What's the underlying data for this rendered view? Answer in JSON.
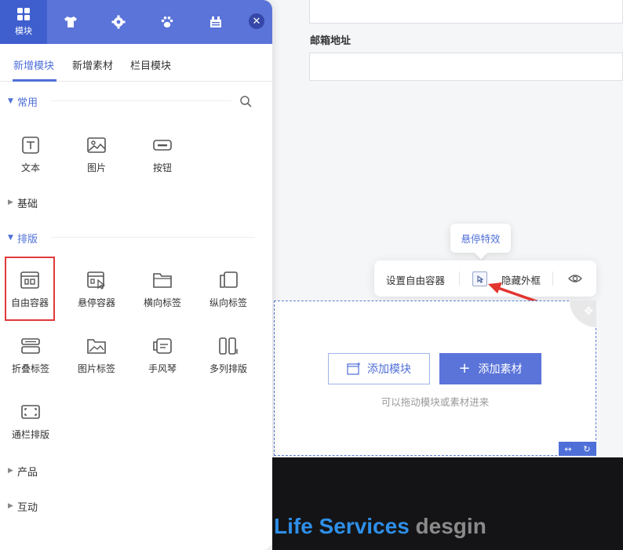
{
  "canvas": {
    "email_label": "邮箱地址",
    "tooltip": "悬停特效",
    "toolbar": {
      "set_free_container": "设置自由容器",
      "hover_effect_icon": "cursor-square-icon",
      "hide_border": "隐藏外框",
      "preview_icon": "eye-icon"
    },
    "free_box": {
      "add_module_label": "添加模块",
      "add_material_label": "添加素材",
      "drag_hint": "可以拖动模块或素材进来",
      "controls": [
        "↔",
        "↻"
      ]
    },
    "footer": {
      "text_highlight": "Life Services",
      "text_rest": " desgin"
    },
    "colors": {
      "accent": "#5a74d9",
      "accent_dark": "#3f5fcf",
      "selection_red": "#e03a3a",
      "footer_bg": "#141416"
    }
  },
  "panel": {
    "head_tabs": [
      {
        "label": "模块",
        "icon": "grid-icon",
        "active": true
      },
      {
        "label": "",
        "icon": "shirt-icon"
      },
      {
        "label": "",
        "icon": "gear-icon"
      },
      {
        "label": "",
        "icon": "paw-icon"
      },
      {
        "label": "",
        "icon": "tools-icon"
      }
    ],
    "close_icon": "close-icon",
    "sub_tabs": [
      "新增模块",
      "新增素材",
      "栏目模块"
    ],
    "active_sub_tab": "新增模块",
    "categories": {
      "common": {
        "label": "常用",
        "items": [
          "文本",
          "图片",
          "按钮"
        ]
      },
      "basic": {
        "label": "基础"
      },
      "layout": {
        "label": "排版",
        "items": [
          "自由容器",
          "悬停容器",
          "横向标签",
          "纵向标签",
          "折叠标签",
          "图片标签",
          "手风琴",
          "多列排版",
          "通栏排版"
        ]
      },
      "product": {
        "label": "产品"
      },
      "interaction": {
        "label": "互动"
      }
    },
    "selected_item": "自由容器"
  }
}
